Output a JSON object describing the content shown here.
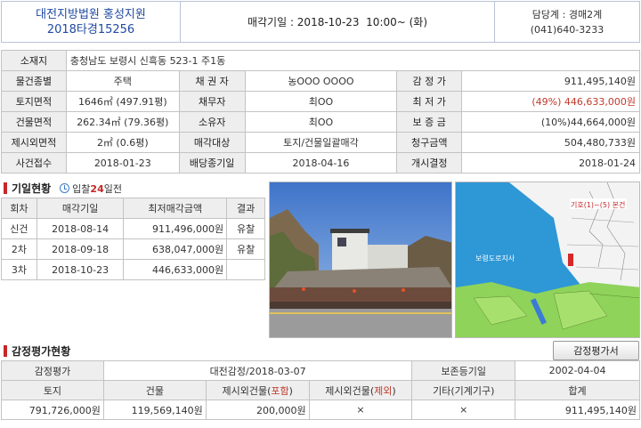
{
  "header": {
    "court": "대전지방법원 홍성지원",
    "case_no": "2018타경15256",
    "sale_date": "매각기일 : 2018-10-23  10:00~ (화)",
    "dept": "담당계 : 경매2계",
    "phone": "(041)640-3233"
  },
  "info": {
    "address_label": "소재지",
    "address": "충청남도 보령시 신흑동 523-1 주1동",
    "rows": [
      [
        "물건종별",
        "주택",
        "채 권 자",
        "농OOO OOOO",
        "감 정 가",
        "911,495,140원"
      ],
      [
        "토지면적",
        "1646㎡ (497.91평)",
        "채무자",
        "최OO",
        "최 저 가",
        "(49%) 446,633,000원"
      ],
      [
        "건물면적",
        "262.34㎡ (79.36평)",
        "소유자",
        "최OO",
        "보 증 금",
        "(10%)44,664,000원"
      ],
      [
        "제시외면적",
        "2㎡ (0.6평)",
        "매각대상",
        "토지/건물일괄매각",
        "청구금액",
        "504,480,733원"
      ],
      [
        "사건접수",
        "2018-01-23",
        "배당종기일",
        "2018-04-16",
        "개시결정",
        "2018-01-24"
      ]
    ]
  },
  "history": {
    "title": "기일현황",
    "countdown_prefix": "입찰",
    "countdown_days": "24",
    "countdown_suffix": "일전",
    "headers": [
      "회차",
      "매각기일",
      "최저매각금액",
      "결과"
    ],
    "rows": [
      [
        "신건",
        "2018-08-14",
        "911,496,000원",
        "유찰"
      ],
      [
        "2차",
        "2018-09-18",
        "638,047,000원",
        "유찰"
      ],
      [
        "3차",
        "2018-10-23",
        "446,633,000원",
        ""
      ]
    ]
  },
  "map": {
    "label1": "기호(1)~(5) 본건",
    "label2": "보령도로지사"
  },
  "appraisal": {
    "title": "감정평가현황",
    "button": "감정평가서",
    "r1": [
      "감정평가",
      "대전감정/2018-03-07",
      "보존등기일",
      "2002-04-04"
    ],
    "headers": {
      "land": "토지",
      "building": "건물",
      "extra_incl_pre": "제시외건물(",
      "extra_incl_mid": "포함",
      "extra_incl_post": ")",
      "extra_excl_pre": "제시외건물(",
      "extra_excl_mid": "제외",
      "extra_excl_post": ")",
      "other": "기타(기계기구)",
      "total": "합계"
    },
    "values": [
      "791,726,000원",
      "119,569,140원",
      "200,000원",
      "×",
      "×",
      "911,495,140원"
    ]
  },
  "colors": {
    "accent": "#c62828",
    "court_blue": "#1f4aa0",
    "label_bg": "#eeeeee"
  }
}
